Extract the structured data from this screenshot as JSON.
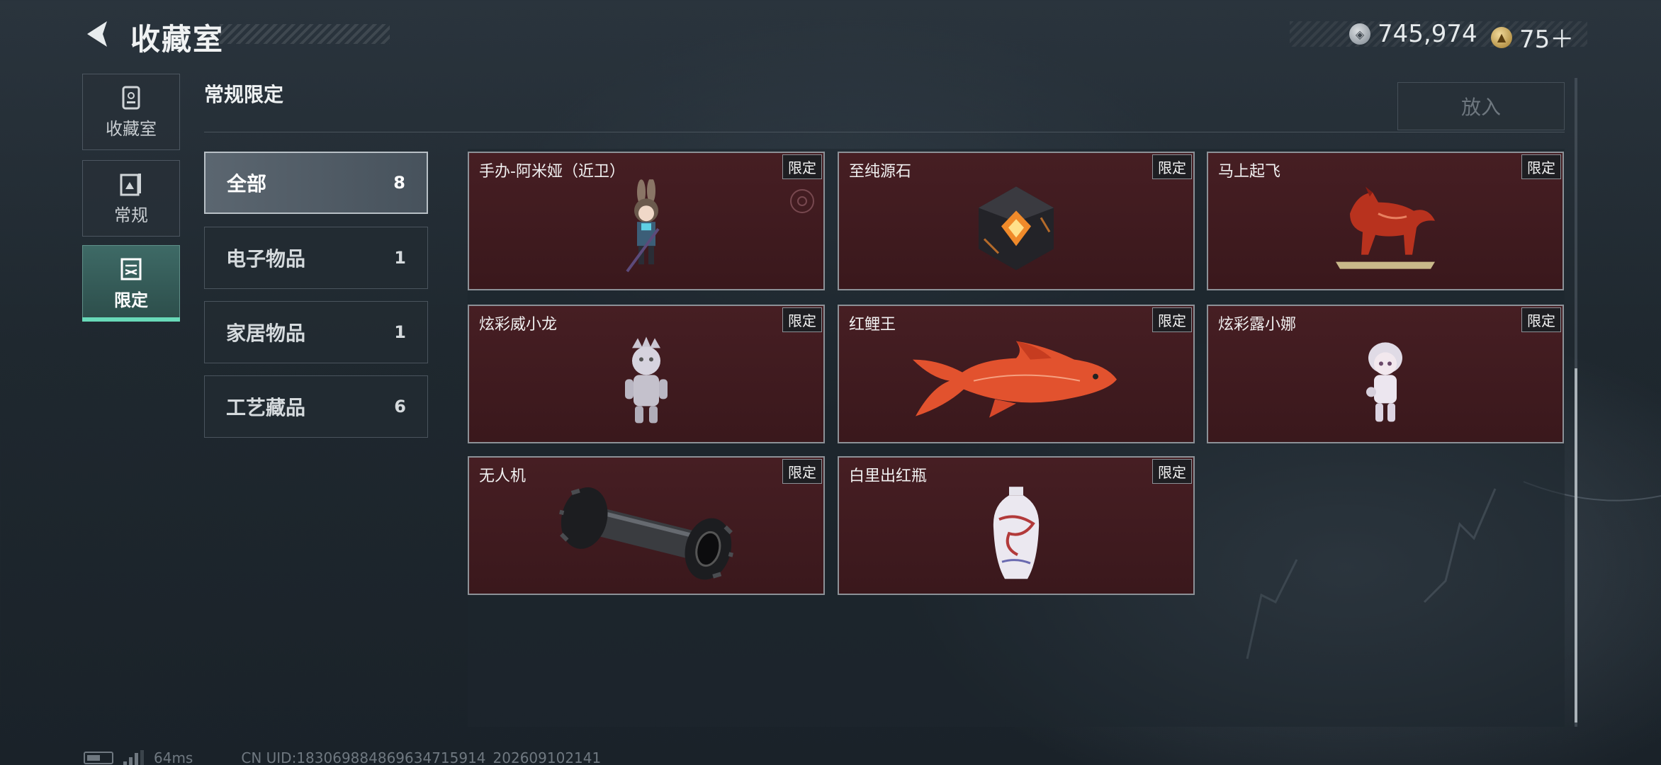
{
  "header": {
    "title": "收藏室",
    "currency_silver": "745,974",
    "currency_gold": "75＋"
  },
  "rail": {
    "items": [
      {
        "label": "收藏室",
        "icon": "collection-room-icon"
      },
      {
        "label": "常规",
        "icon": "regular-icon"
      },
      {
        "label": "限定",
        "icon": "limited-icon",
        "active": true
      }
    ]
  },
  "section": {
    "title": "常规限定",
    "place_button": "放入"
  },
  "categories": [
    {
      "label": "全部",
      "count": "8",
      "active": true
    },
    {
      "label": "电子物品",
      "count": "1"
    },
    {
      "label": "家居物品",
      "count": "1"
    },
    {
      "label": "工艺藏品",
      "count": "6"
    }
  ],
  "items": [
    {
      "name": "手办-阿米娅（近卫）",
      "tag": "限定"
    },
    {
      "name": "至纯源石",
      "tag": "限定"
    },
    {
      "name": "马上起飞",
      "tag": "限定"
    },
    {
      "name": "炫彩威小龙",
      "tag": "限定"
    },
    {
      "name": "红鲤王",
      "tag": "限定"
    },
    {
      "name": "炫彩露小娜",
      "tag": "限定"
    },
    {
      "name": "无人机",
      "tag": "限定"
    },
    {
      "name": "白里出红瓶",
      "tag": "限定"
    }
  ],
  "footer": {
    "ping": "64ms",
    "uid": "CN UID:183069884869634715914_202609102141"
  },
  "colors": {
    "accent": "#68d9b8",
    "card_bg": "#461e23",
    "background": "#1f282f"
  }
}
